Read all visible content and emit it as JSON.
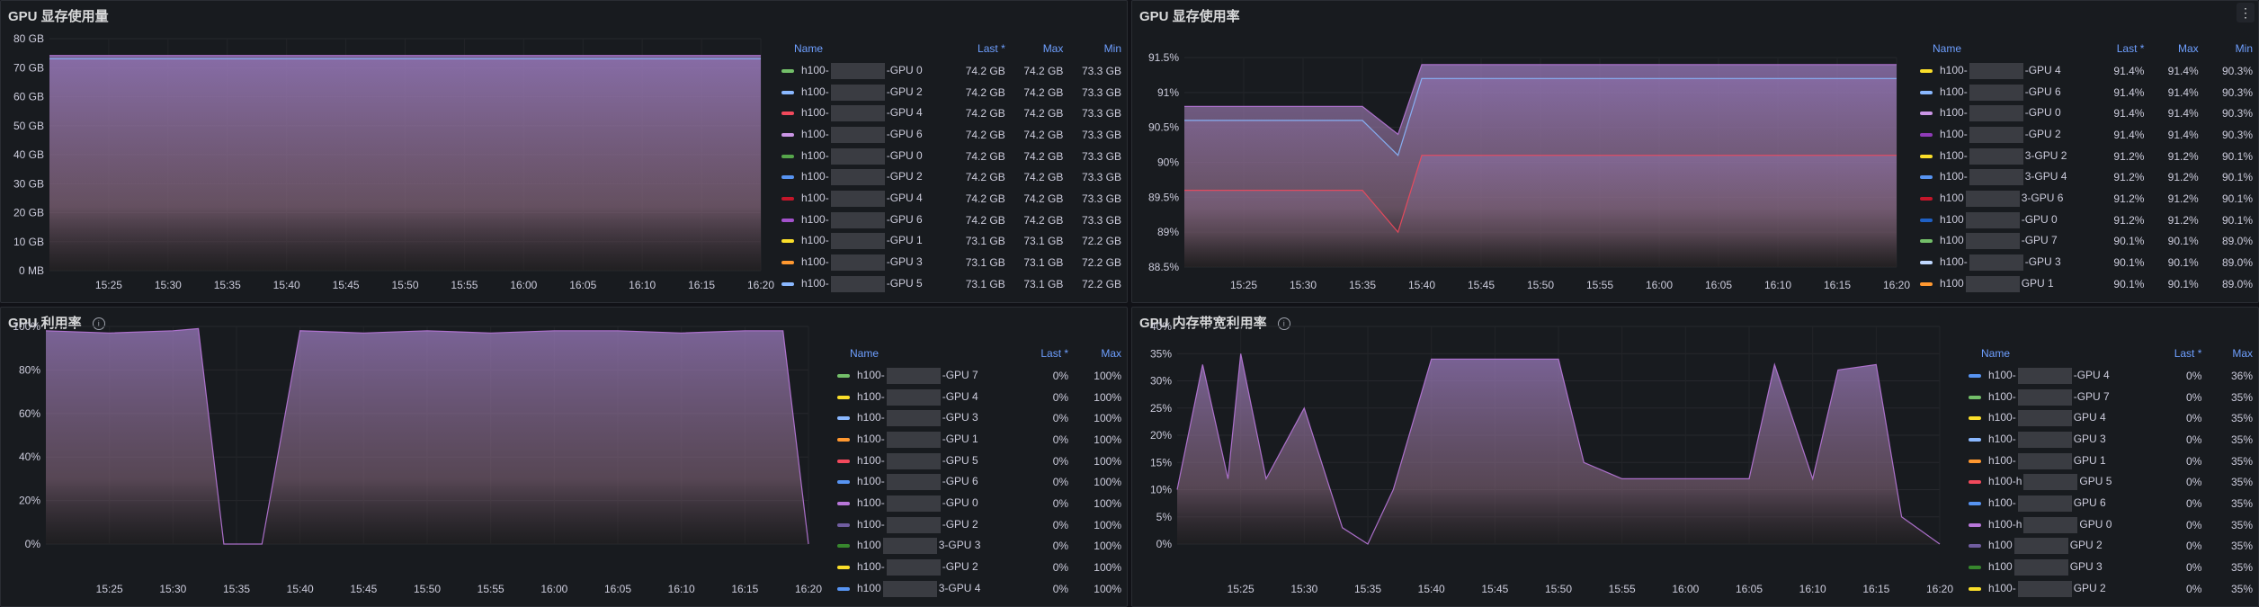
{
  "panels": [
    {
      "title": "GPU 显存使用量",
      "info": false,
      "menu": false,
      "yticks": [
        "80 GB",
        "70 GB",
        "60 GB",
        "50 GB",
        "40 GB",
        "30 GB",
        "20 GB",
        "10 GB",
        "0 MB"
      ],
      "xticks": [
        "15:25",
        "15:30",
        "15:35",
        "15:40",
        "15:45",
        "15:50",
        "15:55",
        "16:00",
        "16:05",
        "16:10",
        "16:15",
        "16:20"
      ],
      "cols": [
        "Name",
        "Last *",
        "Max",
        "Min"
      ],
      "rows": [
        {
          "name": "h100-",
          "suf": "-GPU 0",
          "c": "#73bf69",
          "v": [
            "74.2 GB",
            "74.2 GB",
            "73.3 GB"
          ]
        },
        {
          "name": "h100-",
          "suf": "-GPU 2",
          "c": "#8ab8ff",
          "v": [
            "74.2 GB",
            "74.2 GB",
            "73.3 GB"
          ]
        },
        {
          "name": "h100-",
          "suf": "-GPU 4",
          "c": "#f2495c",
          "v": [
            "74.2 GB",
            "74.2 GB",
            "73.3 GB"
          ]
        },
        {
          "name": "h100-",
          "suf": "-GPU 6",
          "c": "#ca95e5",
          "v": [
            "74.2 GB",
            "74.2 GB",
            "73.3 GB"
          ]
        },
        {
          "name": "h100-",
          "suf": "-GPU 0",
          "c": "#56a64b",
          "v": [
            "74.2 GB",
            "74.2 GB",
            "73.3 GB"
          ]
        },
        {
          "name": "h100-",
          "suf": "-GPU 2",
          "c": "#5794f2",
          "v": [
            "74.2 GB",
            "74.2 GB",
            "73.3 GB"
          ]
        },
        {
          "name": "h100-",
          "suf": "-GPU 4",
          "c": "#c4162a",
          "v": [
            "74.2 GB",
            "74.2 GB",
            "73.3 GB"
          ]
        },
        {
          "name": "h100-",
          "suf": "-GPU 6",
          "c": "#a352cc",
          "v": [
            "74.2 GB",
            "74.2 GB",
            "73.3 GB"
          ]
        },
        {
          "name": "h100-",
          "suf": "-GPU 1",
          "c": "#fade2a",
          "v": [
            "73.1 GB",
            "73.1 GB",
            "72.2 GB"
          ]
        },
        {
          "name": "h100-",
          "suf": "-GPU 3",
          "c": "#ff9830",
          "v": [
            "73.1 GB",
            "73.1 GB",
            "72.2 GB"
          ]
        },
        {
          "name": "h100-",
          "suf": "-GPU 5",
          "c": "#8ab8ff",
          "v": [
            "73.1 GB",
            "73.1 GB",
            "72.2 GB"
          ]
        }
      ]
    },
    {
      "title": "GPU 显存使用率",
      "info": false,
      "menu": true,
      "yticks": [
        "91.5%",
        "91%",
        "90.5%",
        "90%",
        "89.5%",
        "89%",
        "88.5%"
      ],
      "xticks": [
        "15:25",
        "15:30",
        "15:35",
        "15:40",
        "15:45",
        "15:50",
        "15:55",
        "16:00",
        "16:05",
        "16:10",
        "16:15",
        "16:20"
      ],
      "cols": [
        "Name",
        "Last *",
        "Max",
        "Min"
      ],
      "rows": [
        {
          "name": "h100-",
          "suf": "-GPU 4",
          "c": "#fade2a",
          "v": [
            "91.4%",
            "91.4%",
            "90.3%"
          ]
        },
        {
          "name": "h100-",
          "suf": "-GPU 6",
          "c": "#8ab8ff",
          "v": [
            "91.4%",
            "91.4%",
            "90.3%"
          ]
        },
        {
          "name": "h100-",
          "suf": "-GPU 0",
          "c": "#ca95e5",
          "v": [
            "91.4%",
            "91.4%",
            "90.3%"
          ]
        },
        {
          "name": "h100-",
          "suf": "-GPU 2",
          "c": "#8f3bb8",
          "v": [
            "91.4%",
            "91.4%",
            "90.3%"
          ]
        },
        {
          "name": "h100-",
          "suf": "3-GPU 2",
          "c": "#fade2a",
          "v": [
            "91.2%",
            "91.2%",
            "90.1%"
          ]
        },
        {
          "name": "h100-",
          "suf": "3-GPU 4",
          "c": "#5794f2",
          "v": [
            "91.2%",
            "91.2%",
            "90.1%"
          ]
        },
        {
          "name": "h100",
          "suf": "3-GPU 6",
          "c": "#c4162a",
          "v": [
            "91.2%",
            "91.2%",
            "90.1%"
          ]
        },
        {
          "name": "h100",
          "suf": "-GPU 0",
          "c": "#1f60c4",
          "v": [
            "91.2%",
            "91.2%",
            "90.1%"
          ]
        },
        {
          "name": "h100",
          "suf": "-GPU 7",
          "c": "#73bf69",
          "v": [
            "90.1%",
            "90.1%",
            "89.0%"
          ]
        },
        {
          "name": "h100-",
          "suf": "-GPU 3",
          "c": "#c0d8ff",
          "v": [
            "90.1%",
            "90.1%",
            "89.0%"
          ]
        },
        {
          "name": "h100",
          "suf": "GPU 1",
          "c": "#ff9830",
          "v": [
            "90.1%",
            "90.1%",
            "89.0%"
          ]
        }
      ]
    },
    {
      "title": "GPU 利用率",
      "info": true,
      "menu": false,
      "yticks": [
        "100%",
        "80%",
        "60%",
        "40%",
        "20%",
        "0%"
      ],
      "xticks": [
        "15:25",
        "15:30",
        "15:35",
        "15:40",
        "15:45",
        "15:50",
        "15:55",
        "16:00",
        "16:05",
        "16:10",
        "16:15",
        "16:20"
      ],
      "cols": [
        "Name",
        "Last *",
        "Max"
      ],
      "rows": [
        {
          "name": "h100-",
          "suf": "-GPU 7",
          "c": "#73bf69",
          "v": [
            "0%",
            "100%"
          ]
        },
        {
          "name": "h100-",
          "suf": "-GPU 4",
          "c": "#fade2a",
          "v": [
            "0%",
            "100%"
          ]
        },
        {
          "name": "h100-",
          "suf": "-GPU 3",
          "c": "#8ab8ff",
          "v": [
            "0%",
            "100%"
          ]
        },
        {
          "name": "h100-",
          "suf": "-GPU 1",
          "c": "#ff9830",
          "v": [
            "0%",
            "100%"
          ]
        },
        {
          "name": "h100-",
          "suf": "-GPU 5",
          "c": "#f2495c",
          "v": [
            "0%",
            "100%"
          ]
        },
        {
          "name": "h100-",
          "suf": "-GPU 6",
          "c": "#5794f2",
          "v": [
            "0%",
            "100%"
          ]
        },
        {
          "name": "h100-",
          "suf": "-GPU 0",
          "c": "#b877d9",
          "v": [
            "0%",
            "100%"
          ]
        },
        {
          "name": "h100-",
          "suf": "-GPU 2",
          "c": "#705da0",
          "v": [
            "0%",
            "100%"
          ]
        },
        {
          "name": "h100",
          "suf": "3-GPU 3",
          "c": "#37872d",
          "v": [
            "0%",
            "100%"
          ]
        },
        {
          "name": "h100-",
          "suf": "-GPU 2",
          "c": "#fade2a",
          "v": [
            "0%",
            "100%"
          ]
        },
        {
          "name": "h100",
          "suf": "3-GPU 4",
          "c": "#5794f2",
          "v": [
            "0%",
            "100%"
          ]
        }
      ]
    },
    {
      "title": "GPU 内存带宽利用率",
      "info": true,
      "menu": false,
      "yticks": [
        "40%",
        "35%",
        "30%",
        "25%",
        "20%",
        "15%",
        "10%",
        "5%",
        "0%"
      ],
      "xticks": [
        "15:25",
        "15:30",
        "15:35",
        "15:40",
        "15:45",
        "15:50",
        "15:55",
        "16:00",
        "16:05",
        "16:10",
        "16:15",
        "16:20"
      ],
      "cols": [
        "Name",
        "Last *",
        "Max"
      ],
      "rows": [
        {
          "name": "h100-",
          "suf": "-GPU 4",
          "c": "#5794f2",
          "v": [
            "0%",
            "36%"
          ]
        },
        {
          "name": "h100-",
          "suf": "-GPU 7",
          "c": "#73bf69",
          "v": [
            "0%",
            "35%"
          ]
        },
        {
          "name": "h100-",
          "suf": "GPU 4",
          "c": "#fade2a",
          "v": [
            "0%",
            "35%"
          ]
        },
        {
          "name": "h100-",
          "suf": "GPU 3",
          "c": "#8ab8ff",
          "v": [
            "0%",
            "35%"
          ]
        },
        {
          "name": "h100-",
          "suf": "GPU 1",
          "c": "#ff9830",
          "v": [
            "0%",
            "35%"
          ]
        },
        {
          "name": "h100-h",
          "suf": "GPU 5",
          "c": "#f2495c",
          "v": [
            "0%",
            "35%"
          ]
        },
        {
          "name": "h100-",
          "suf": "GPU 6",
          "c": "#5794f2",
          "v": [
            "0%",
            "35%"
          ]
        },
        {
          "name": "h100-h",
          "suf": "GPU 0",
          "c": "#b877d9",
          "v": [
            "0%",
            "35%"
          ]
        },
        {
          "name": "h100",
          "suf": "GPU 2",
          "c": "#705da0",
          "v": [
            "0%",
            "35%"
          ]
        },
        {
          "name": "h100",
          "suf": "GPU 3",
          "c": "#37872d",
          "v": [
            "0%",
            "35%"
          ]
        },
        {
          "name": "h100-",
          "suf": "GPU 2",
          "c": "#fade2a",
          "v": [
            "0%",
            "35%"
          ]
        }
      ]
    }
  ],
  "chart_data": [
    {
      "type": "area",
      "title": "GPU 显存使用量",
      "ylim": [
        0,
        80
      ],
      "unit": "GB",
      "x": [
        "15:20",
        "15:25",
        "15:30",
        "15:35",
        "15:40",
        "15:45",
        "15:50",
        "15:55",
        "16:00",
        "16:05",
        "16:10",
        "16:15",
        "16:20"
      ],
      "series": [
        {
          "name": "h100- -GPU 0",
          "values": [
            74.2,
            74.2,
            74.2,
            74.2,
            74.2,
            74.2,
            74.2,
            74.2,
            74.2,
            74.2,
            74.2,
            74.2,
            74.2
          ]
        },
        {
          "name": "h100- -GPU 1",
          "values": [
            73.1,
            73.1,
            73.1,
            73.1,
            73.1,
            73.1,
            73.1,
            73.1,
            73.1,
            73.1,
            73.1,
            73.1,
            73.1
          ]
        }
      ]
    },
    {
      "type": "area",
      "title": "GPU 显存使用率",
      "ylim": [
        88.5,
        91.5
      ],
      "unit": "%",
      "x": [
        "15:20",
        "15:25",
        "15:30",
        "15:35",
        "15:38",
        "15:40",
        "15:45",
        "16:20"
      ],
      "series": [
        {
          "name": "h100- -GPU 4",
          "values": [
            90.8,
            90.8,
            90.8,
            90.8,
            90.4,
            91.4,
            91.4,
            91.4
          ]
        },
        {
          "name": "h100- 3-GPU 2",
          "values": [
            90.6,
            90.6,
            90.6,
            90.6,
            90.1,
            91.2,
            91.2,
            91.2
          ]
        },
        {
          "name": "h100- -GPU 7",
          "values": [
            89.6,
            89.6,
            89.6,
            89.6,
            89.0,
            90.1,
            90.1,
            90.1
          ]
        }
      ]
    },
    {
      "type": "area",
      "title": "GPU 利用率",
      "ylim": [
        0,
        100
      ],
      "unit": "%",
      "x": [
        "15:20",
        "15:25",
        "15:30",
        "15:32",
        "15:34",
        "15:35",
        "15:37",
        "15:40",
        "15:45",
        "15:50",
        "15:55",
        "16:00",
        "16:05",
        "16:10",
        "16:15",
        "16:18",
        "16:20"
      ],
      "series": [
        {
          "name": "h100- -GPU 7",
          "values": [
            98,
            97,
            98,
            99,
            0,
            0,
            0,
            98,
            97,
            98,
            97,
            98,
            98,
            97,
            98,
            98,
            0
          ]
        }
      ]
    },
    {
      "type": "line",
      "title": "GPU 内存带宽利用率",
      "ylim": [
        0,
        40
      ],
      "unit": "%",
      "x": [
        "15:20",
        "15:22",
        "15:24",
        "15:25",
        "15:27",
        "15:30",
        "15:33",
        "15:35",
        "15:37",
        "15:40",
        "15:45",
        "15:50",
        "15:52",
        "15:55",
        "16:00",
        "16:05",
        "16:07",
        "16:10",
        "16:12",
        "16:15",
        "16:17",
        "16:20"
      ],
      "series": [
        {
          "name": "h100- -GPU 4",
          "values": [
            10,
            33,
            12,
            35,
            12,
            25,
            3,
            0,
            10,
            34,
            34,
            34,
            15,
            12,
            12,
            12,
            33,
            12,
            32,
            33,
            5,
            0
          ]
        }
      ]
    }
  ]
}
